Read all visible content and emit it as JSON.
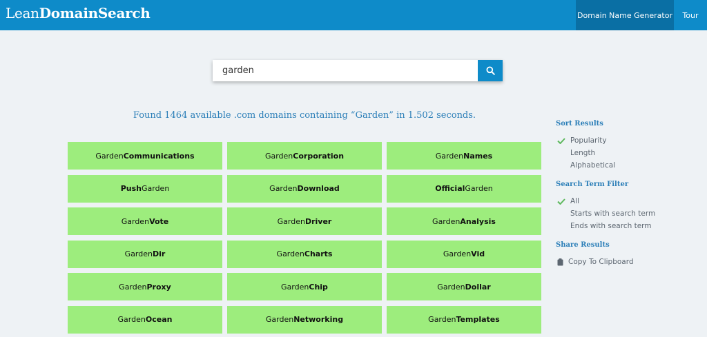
{
  "header": {
    "logo_light": "Lean",
    "logo_bold": "DomainSearch",
    "nav": [
      "Domain Name Generator",
      "Tour"
    ]
  },
  "search": {
    "value": "garden"
  },
  "summary": "Found 1464 available .com domains containing “Garden” in 1.502 seconds.",
  "results": [
    {
      "pre": "Garden",
      "bold": "Communications",
      "post": ""
    },
    {
      "pre": "Garden",
      "bold": "Corporation",
      "post": ""
    },
    {
      "pre": "Garden",
      "bold": "Names",
      "post": ""
    },
    {
      "pre": "",
      "bold": "Push",
      "post": "Garden"
    },
    {
      "pre": "Garden",
      "bold": "Download",
      "post": ""
    },
    {
      "pre": "",
      "bold": "Official",
      "post": "Garden"
    },
    {
      "pre": "Garden",
      "bold": "Vote",
      "post": ""
    },
    {
      "pre": "Garden",
      "bold": "Driver",
      "post": ""
    },
    {
      "pre": "Garden",
      "bold": "Analysis",
      "post": ""
    },
    {
      "pre": "Garden",
      "bold": "Dir",
      "post": ""
    },
    {
      "pre": "Garden",
      "bold": "Charts",
      "post": ""
    },
    {
      "pre": "Garden",
      "bold": "Vid",
      "post": ""
    },
    {
      "pre": "Garden",
      "bold": "Proxy",
      "post": ""
    },
    {
      "pre": "Garden",
      "bold": "Chip",
      "post": ""
    },
    {
      "pre": "Garden",
      "bold": "Dollar",
      "post": ""
    },
    {
      "pre": "Garden",
      "bold": "Ocean",
      "post": ""
    },
    {
      "pre": "Garden",
      "bold": "Networking",
      "post": ""
    },
    {
      "pre": "Garden",
      "bold": "Templates",
      "post": ""
    }
  ],
  "sidebar": {
    "sort_heading": "Sort Results",
    "sort_options": [
      "Popularity",
      "Length",
      "Alphabetical"
    ],
    "sort_selected": "Popularity",
    "filter_heading": "Search Term Filter",
    "filter_options": [
      "All",
      "Starts with search term",
      "Ends with search term"
    ],
    "filter_selected": "All",
    "share_heading": "Share Results",
    "copy_label": "Copy To Clipboard"
  },
  "colors": {
    "brand": "#0e8bc9",
    "tile": "#9ded7d",
    "accent_text": "#2c7fb8",
    "check": "#5cb85c"
  },
  "icons": [
    "search-icon",
    "check-icon",
    "clipboard-icon"
  ]
}
